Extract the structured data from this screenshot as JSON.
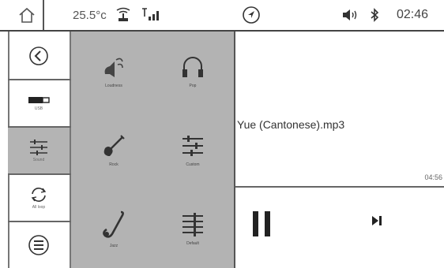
{
  "status": {
    "temperature": "25.5°c",
    "time": "02:46"
  },
  "sidebar": {
    "items": [
      {
        "icon": "back-arrow-icon",
        "label": ""
      },
      {
        "icon": "usb-icon",
        "label": "USB"
      },
      {
        "icon": "equalizer-icon",
        "label": "Sound"
      },
      {
        "icon": "repeat-icon",
        "label": "All loop"
      },
      {
        "icon": "list-icon",
        "label": ""
      }
    ]
  },
  "grid": {
    "tiles": [
      {
        "icon": "speaker-icon",
        "label": "Loudness"
      },
      {
        "icon": "headphones-icon",
        "label": "Pop"
      },
      {
        "icon": "guitar-icon",
        "label": "Rock"
      },
      {
        "icon": "sliders-icon",
        "label": "Custom"
      },
      {
        "icon": "saxophone-icon",
        "label": "Jazz"
      },
      {
        "icon": "equalizer-bars-icon",
        "label": "Default"
      }
    ]
  },
  "player": {
    "track_name": "Yue (Cantonese).mp3",
    "duration": "04:56"
  },
  "colors": {
    "panel_gray": "#b3b3b3",
    "active_gray": "#b4b4b4",
    "line": "#555555"
  }
}
